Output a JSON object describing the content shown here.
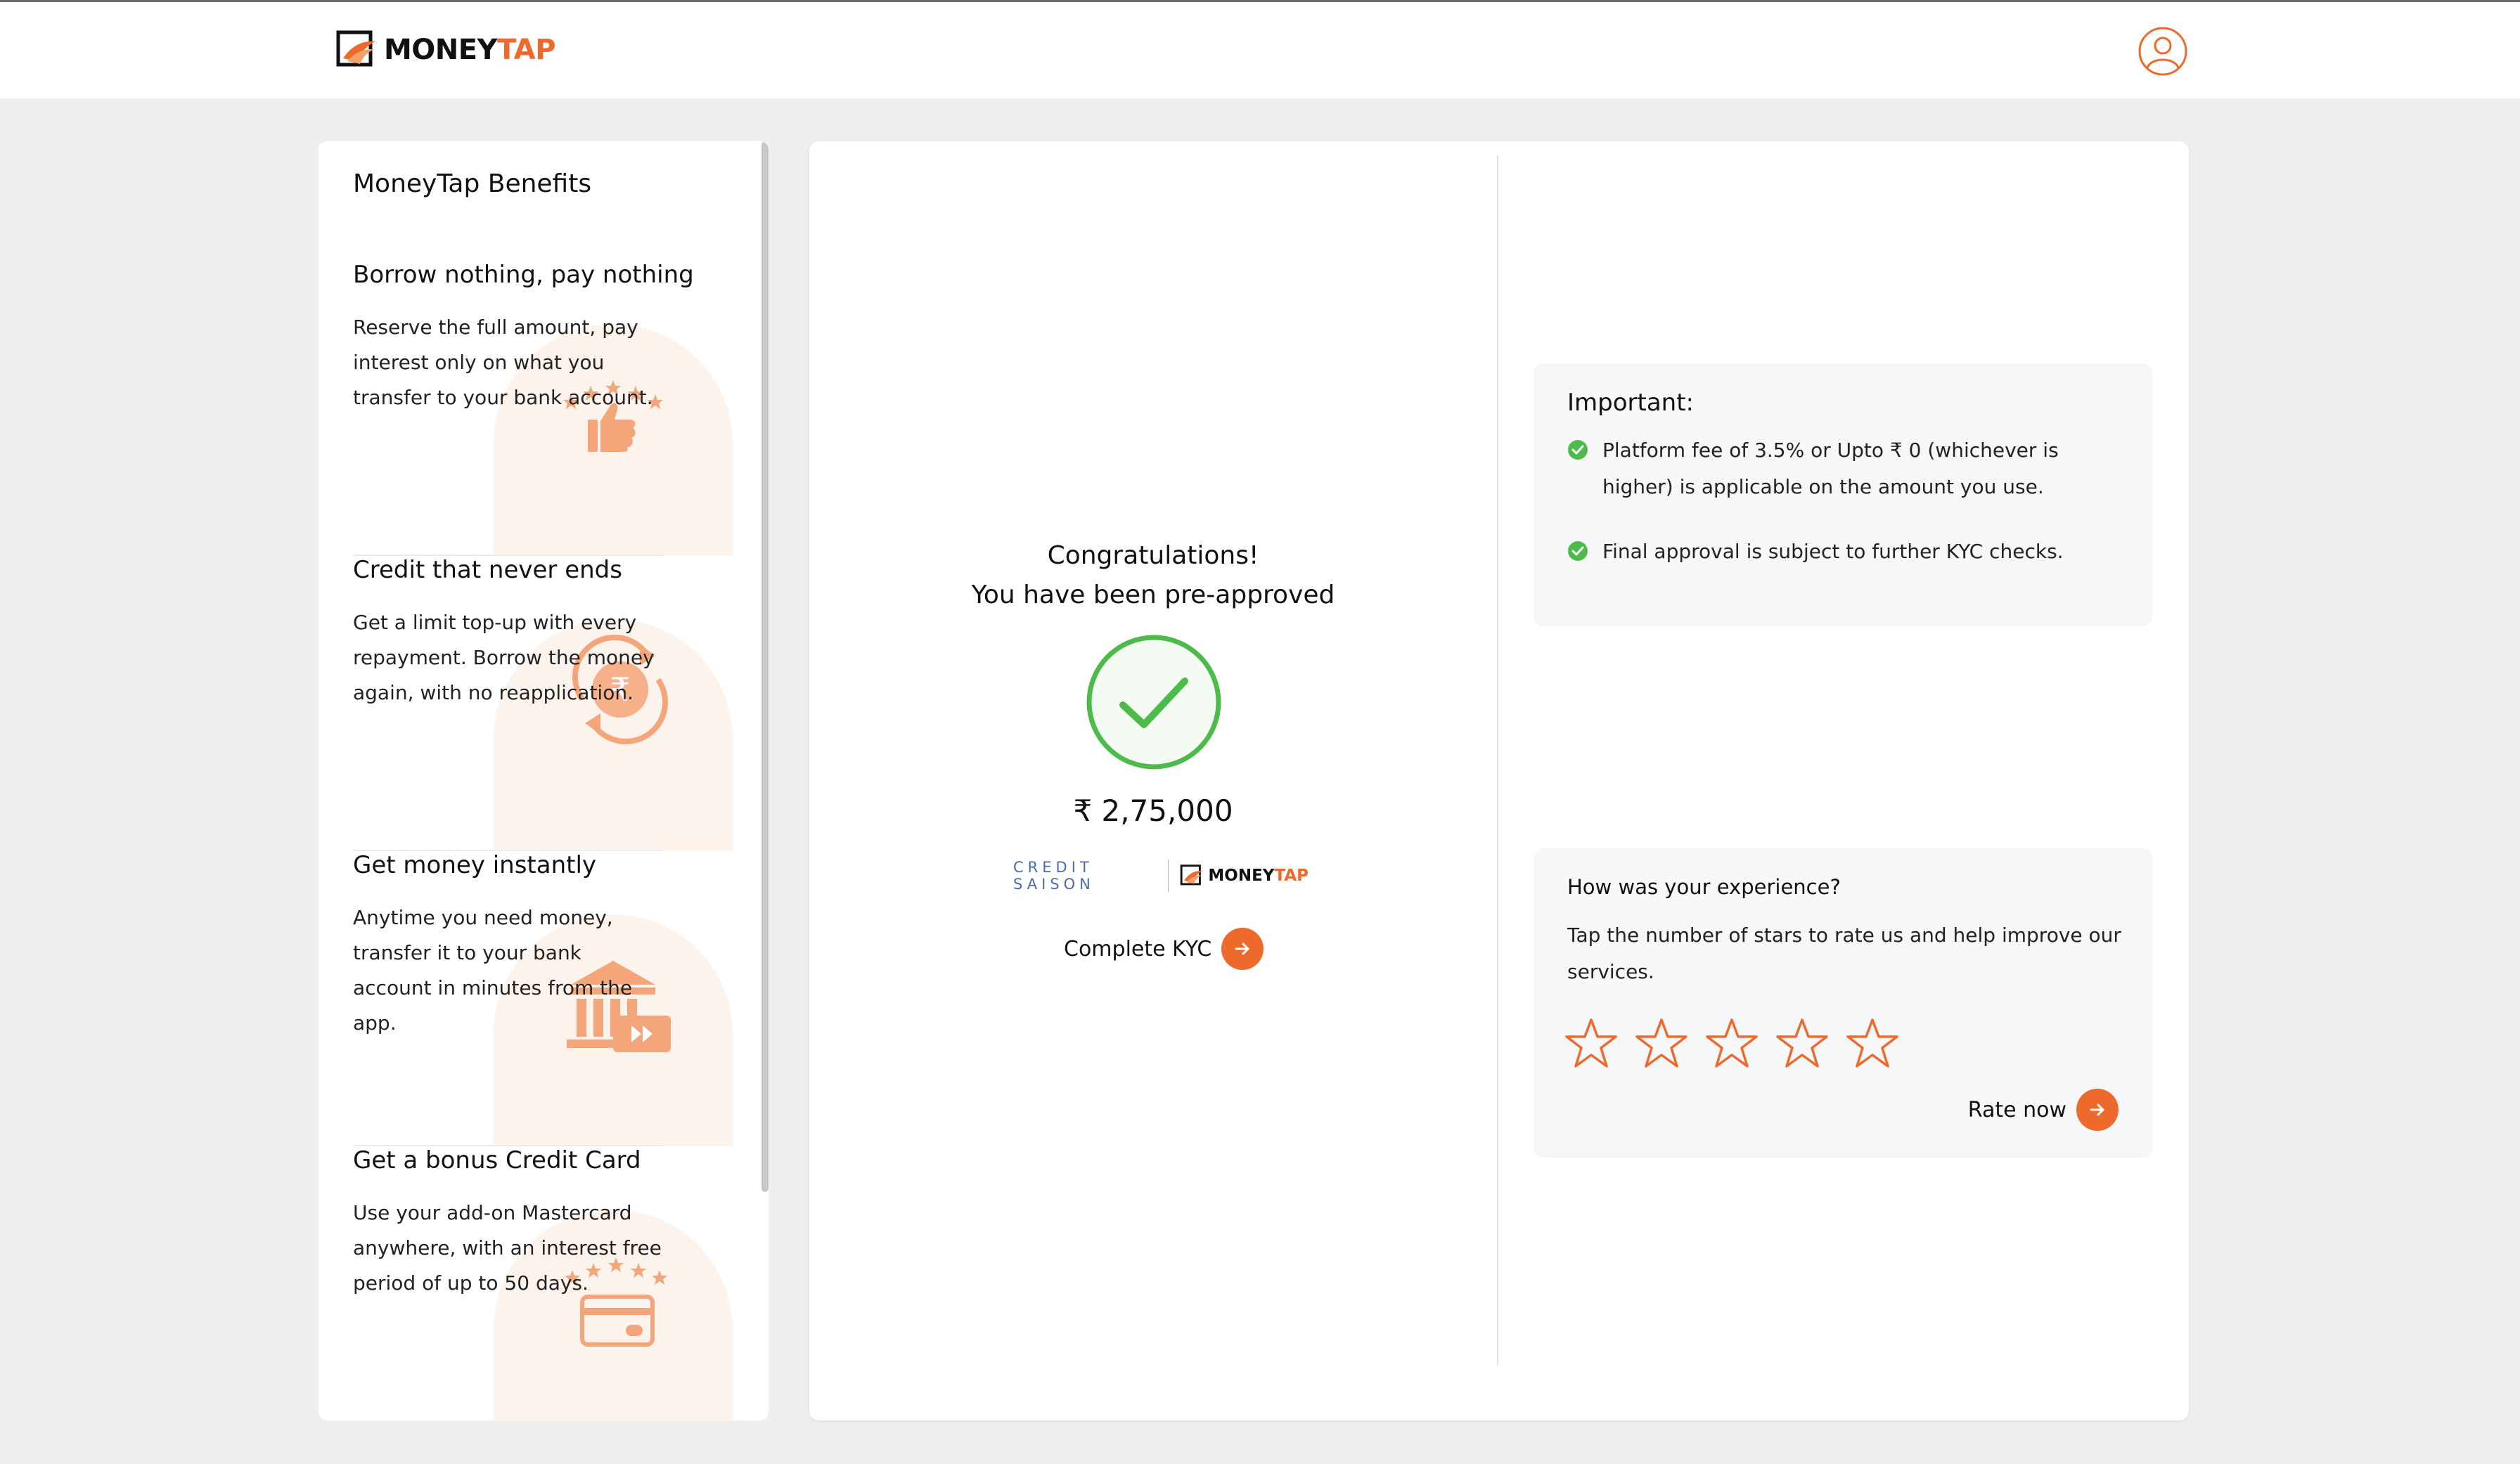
{
  "brand": {
    "name_part1": "MONEY",
    "name_part2": "TAP",
    "accent": "#ee6a2c"
  },
  "header": {
    "profile_icon": "user-icon"
  },
  "sidebar": {
    "title": "MoneyTap Benefits",
    "benefits": [
      {
        "title": "Borrow nothing, pay nothing",
        "desc": "Reserve the full amount, pay interest only on what you transfer to your bank account.",
        "icon": "thumbs-up-stars-icon"
      },
      {
        "title": "Credit that never ends",
        "desc": "Get a limit top-up with every repayment. Borrow the money again, with no reapplication.",
        "icon": "rupee-cycle-icon"
      },
      {
        "title": "Get money instantly",
        "desc": "Anytime you need money, transfer it to your bank account in minutes from the app.",
        "icon": "bank-fast-forward-icon"
      },
      {
        "title": "Get a bonus Credit Card",
        "desc": "Use your add-on Mastercard anywhere, with an interest free period of up to 50 days.",
        "icon": "credit-card-stars-icon"
      }
    ]
  },
  "main": {
    "congrats_line1": "Congratulations!",
    "congrats_line2": "You have been pre-approved",
    "amount": "₹ 2,75,000",
    "partner_name": "CREDIT SAISON",
    "partner_logo_part1": "MONEY",
    "partner_logo_part2": "TAP",
    "kyc_label": "Complete KYC",
    "success_color": "#4cbb4a"
  },
  "important": {
    "title": "Important:",
    "items": [
      "Platform fee of 3.5% or Upto ₹ 0 (whichever is higher) is applicable on the amount you use.",
      "Final approval is subject to further KYC checks."
    ]
  },
  "experience": {
    "title": "How was your experience?",
    "desc": "Tap the number of stars to rate us and help improve our services.",
    "rating_max": 5,
    "rating_selected": 0,
    "rate_label": "Rate now"
  }
}
